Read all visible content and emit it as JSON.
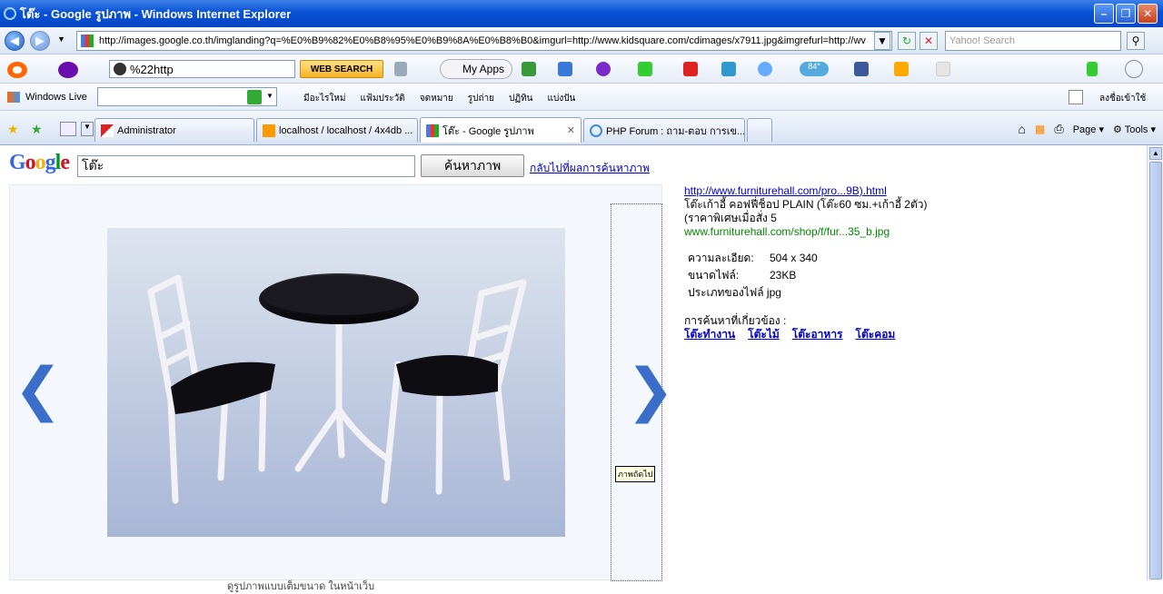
{
  "window": {
    "title": "โต๊ะ - Google รูปภาพ - Windows Internet Explorer",
    "url": "http://images.google.co.th/imglanding?q=%E0%B9%82%E0%B8%95%E0%B9%8A%E0%B8%B0&imgurl=http://www.kidsquare.com/cdimages/x7911.jpg&imgrefurl=http://wv",
    "search_placeholder": "Yahoo! Search"
  },
  "yahoo_toolbar": {
    "query": "%22http",
    "web_search_label": "WEB SEARCH",
    "my_apps_label": "My Apps",
    "weather": "84°"
  },
  "live_toolbar": {
    "brand": "Windows Live",
    "links": [
      "มีอะไรใหม่",
      "แฟ้มประวัติ",
      "จดหมาย",
      "รูปถ่าย",
      "ปฏิทิน",
      "แบ่งปัน"
    ],
    "signin": "ลงชื่อเข้าใช้"
  },
  "tabs": [
    {
      "label": "Administrator"
    },
    {
      "label": "localhost / localhost / 4x4db ..."
    },
    {
      "label": "โต๊ะ - Google รูปภาพ"
    },
    {
      "label": "PHP Forum : ถาม-ตอบ การเข..."
    }
  ],
  "commands": {
    "page": "Page",
    "tools": "Tools"
  },
  "google": {
    "logo": "Google",
    "query": "โต๊ะ",
    "search_button": "ค้นหาภาพ",
    "back_link": "กลับไปที่ผลการค้นหาภาพ"
  },
  "viewer": {
    "next_tooltip": "ภาพถัดไป",
    "caption": "ดูรูปภาพแบบเต็มขนาด ในหน้าเว็บ"
  },
  "result": {
    "source_link": "http://www.furniturehall.com/pro...9B).html",
    "title": "โต๊ะเก้าอี้ คอฟฟี่ช็อป PLAIN (โต๊ะ60 ซม.+เก้าอี้ 2ตัว)",
    "desc": "(ราคาพิเศษเมื่อสั่ง 5",
    "image_url": "www.furniturehall.com/shop/f/fur...35_b.jpg",
    "resolution_label": "ความละเอียด:",
    "resolution": "504 x 340",
    "size_label": "ขนาดไฟล์:",
    "size": "23KB",
    "type_text": "ประเภทของไฟล์ jpg",
    "related_label": "การค้นหาที่เกี่ยวข้อง :",
    "related": [
      "โต๊ะทำงาน",
      "โต๊ะไม้",
      "โต๊ะอาหาร",
      "โต๊ะคอม"
    ]
  }
}
